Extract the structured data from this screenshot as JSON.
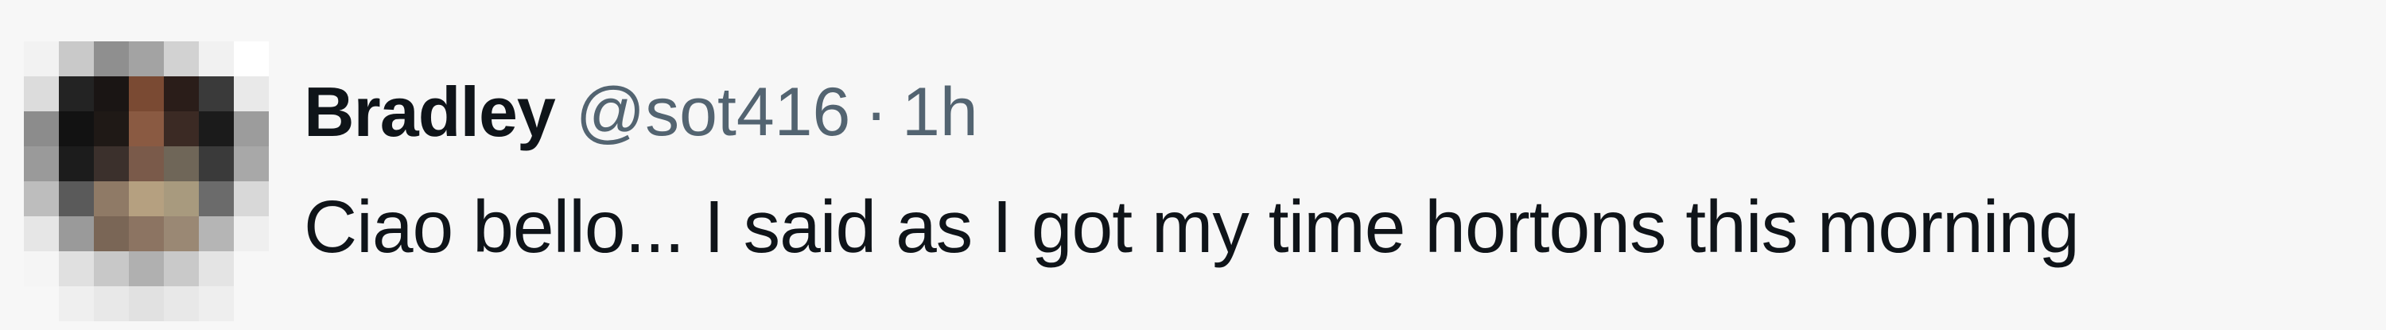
{
  "tweet": {
    "author": {
      "display_name": "Bradley",
      "handle": "@sot416",
      "avatar": "pixelated-avatar"
    },
    "separator": "·",
    "timestamp": "1h",
    "text": "Ciao bello... I said as I got my time hortons this morning"
  },
  "colors": {
    "background": "#f7f7f7",
    "primary_text": "#0f1419",
    "secondary_text": "#536471"
  }
}
